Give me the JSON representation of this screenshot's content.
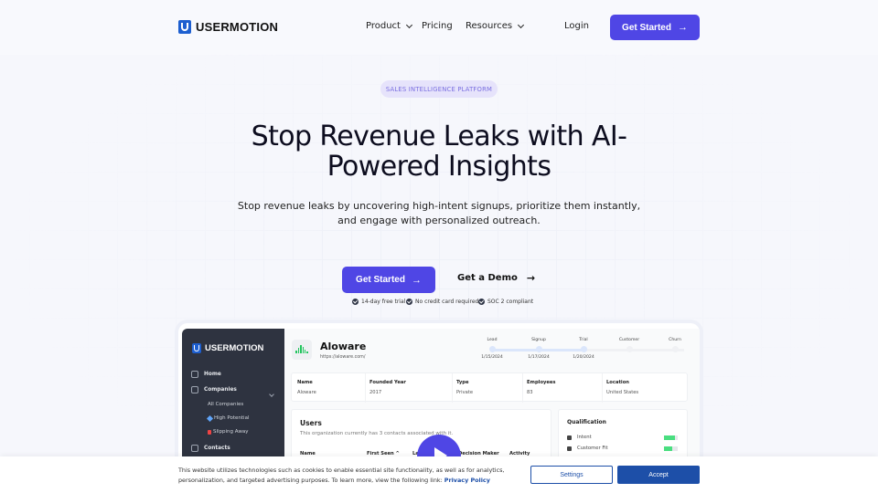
{
  "nav": {
    "brand": "USERMOTION",
    "links": [
      {
        "label": "Product",
        "has_dropdown": true
      },
      {
        "label": "Pricing",
        "has_dropdown": false
      },
      {
        "label": "Resources",
        "has_dropdown": true
      }
    ],
    "login": "Login",
    "cta": "Get Started",
    "cta_icon": "→"
  },
  "hero": {
    "badge": "SALES INTELLIGENCE PLATFORM",
    "title": "Stop Revenue Leaks with AI-Powered Insights",
    "subtitle": "Stop revenue leaks by uncovering high-intent signups, prioritize them instantly, and engage with personalized outreach.",
    "primary_cta": "Get Started",
    "secondary_cta": "Get a Demo",
    "arrow": "→",
    "trust": [
      "14-day free trial",
      "No credit card required",
      "SOC 2 compliant"
    ]
  },
  "app": {
    "brand": "USERMOTION",
    "sidebar": [
      {
        "label": "Home",
        "icon": "home-icon"
      },
      {
        "label": "Companies",
        "icon": "building-icon"
      },
      {
        "label": "All Companies"
      },
      {
        "label": "High Potential",
        "icon": "gem-icon"
      },
      {
        "label": "Slipping Away",
        "icon": "flag-icon"
      },
      {
        "label": "Contacts",
        "icon": "users-icon"
      }
    ],
    "company": {
      "name": "Aloware",
      "url": "https://aloware.com/"
    },
    "stages": [
      {
        "label": "Lead",
        "date": "1/15/2024",
        "done": true
      },
      {
        "label": "Signup",
        "date": "1/17/2024",
        "done": true
      },
      {
        "label": "Trial",
        "date": "1/20/2024",
        "done": true
      },
      {
        "label": "Customer",
        "date": "",
        "done": false
      },
      {
        "label": "Churn",
        "date": "",
        "done": false
      }
    ],
    "info": [
      {
        "h": "Name",
        "v": "Aloware"
      },
      {
        "h": "Founded Year",
        "v": "2017"
      },
      {
        "h": "Type",
        "v": "Private"
      },
      {
        "h": "Employees",
        "v": "83"
      },
      {
        "h": "Location",
        "v": "United States"
      }
    ],
    "users": {
      "title": "Users",
      "desc": "This organization currently has 3 contacts associated with it.",
      "columns": [
        "Name",
        "First Seen ^",
        "La",
        "Decision Maker",
        "Activity"
      ]
    },
    "qualification": {
      "title": "Qualification",
      "rows": [
        {
          "label": "Intent",
          "score": 0.8
        },
        {
          "label": "Customer Fit",
          "score": 0.6
        }
      ]
    }
  },
  "cookie": {
    "text": "This website utilizes technologies such as cookies to enable essential site functionality, as well as for analytics, personalization, and targeted advertising purposes. To learn more, view the following link:",
    "link": "Privacy Policy",
    "settings": "Settings",
    "accept": "Accept"
  }
}
